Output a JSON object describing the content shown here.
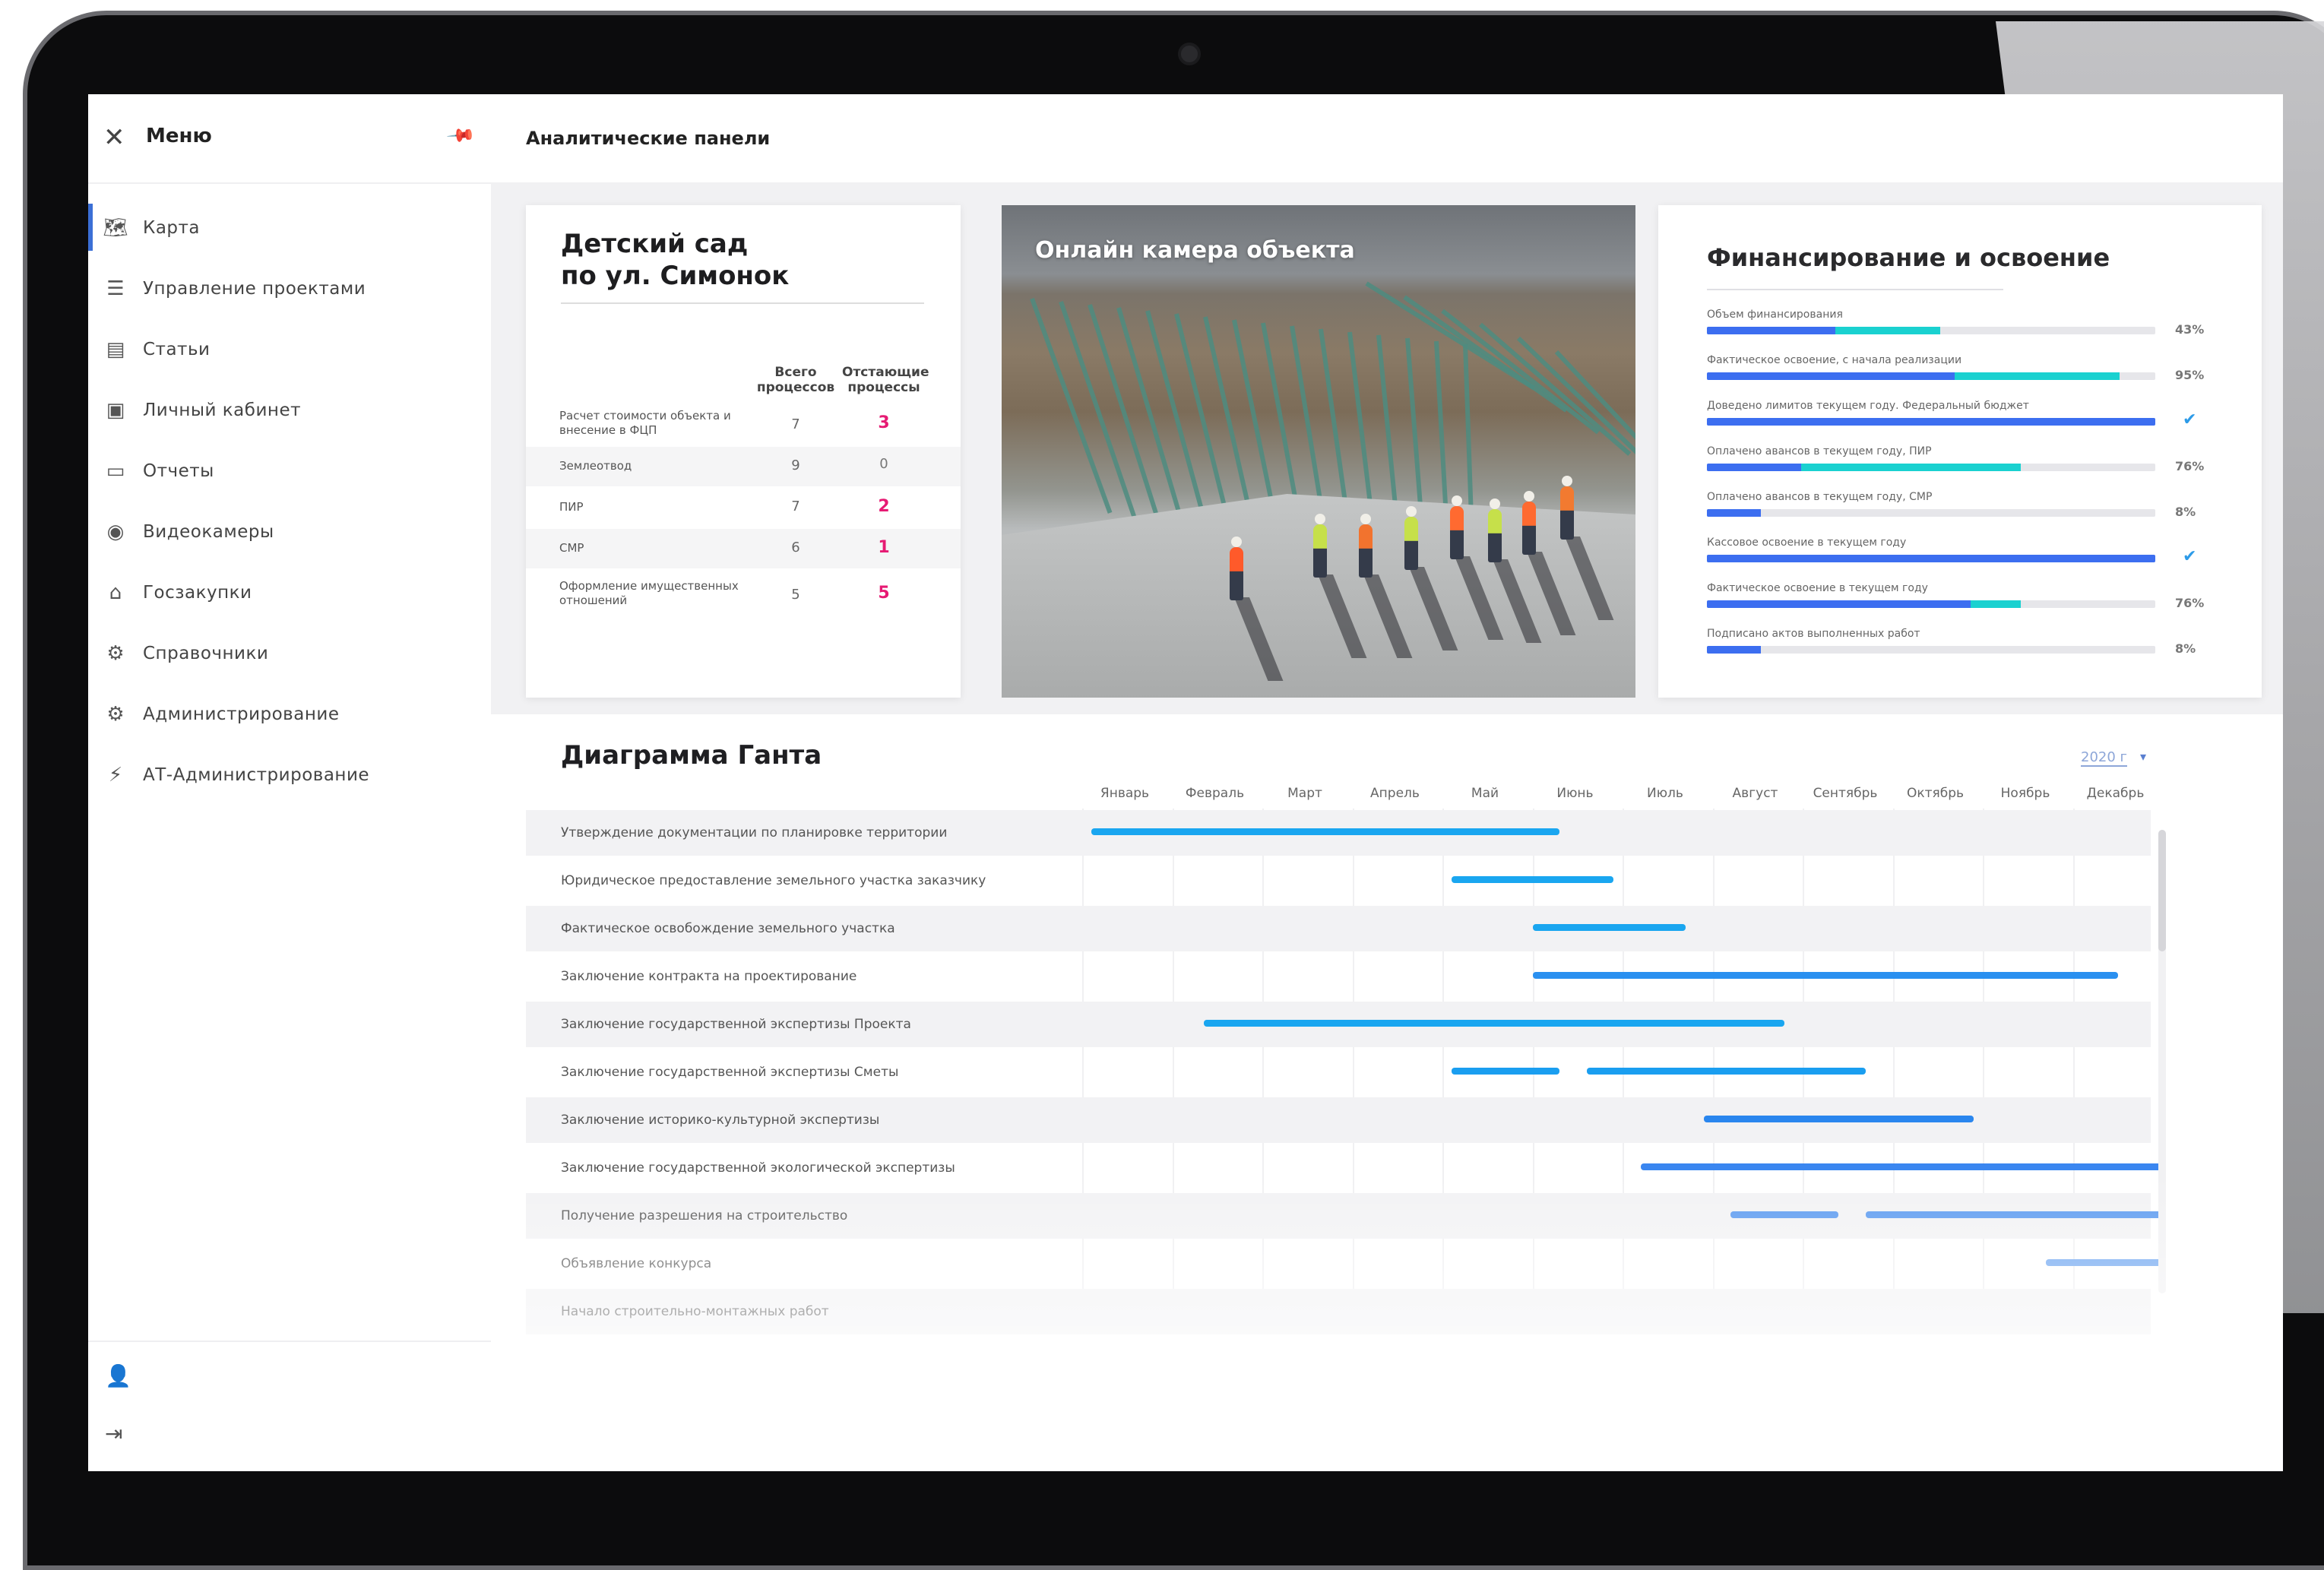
{
  "sidebar": {
    "title": "Меню",
    "items": [
      {
        "label": "Карта",
        "icon": "map-icon",
        "active": true
      },
      {
        "label": "Управление проектами",
        "icon": "project-manage-icon"
      },
      {
        "label": "Статьи",
        "icon": "article-icon"
      },
      {
        "label": "Личный кабинет",
        "icon": "profile-icon"
      },
      {
        "label": "Отчеты",
        "icon": "folder-icon"
      },
      {
        "label": "Видеокамеры",
        "icon": "camera-icon"
      },
      {
        "label": "Госзакупки",
        "icon": "bank-icon"
      },
      {
        "label": "Справочники",
        "icon": "gear-icon"
      },
      {
        "label": "Администрирование",
        "icon": "admin-icon"
      },
      {
        "label": "АТ-Администрирование",
        "icon": "bolt-icon"
      }
    ]
  },
  "header": {
    "title": "Аналитические панели"
  },
  "project_card": {
    "title_line1": "Детский сад",
    "title_line2": "по ул. Симонок",
    "col_total": "Всего процессов",
    "col_lagging": "Отстающие процессы",
    "rows": [
      {
        "label": "Расчет стоимости объекта и внесение в ФЦП",
        "total": "7",
        "lagging": "3"
      },
      {
        "label": "Землеотвод",
        "total": "9",
        "lagging": "0"
      },
      {
        "label": "ПИР",
        "total": "7",
        "lagging": "2"
      },
      {
        "label": "СМР",
        "total": "6",
        "lagging": "1"
      },
      {
        "label": "Оформление имущественных отношений",
        "total": "5",
        "lagging": "5"
      }
    ]
  },
  "camera": {
    "title": "Онлайн камера объекта"
  },
  "finance": {
    "title": "Финансирование и освоение",
    "rows": [
      {
        "label": "Объем финансирования",
        "value": "43%",
        "fill": 0.52,
        "split": 0.55,
        "check": false
      },
      {
        "label": "Фактическое освоение, с начала реализации",
        "value": "95%",
        "fill": 0.92,
        "split": 0.6,
        "check": false
      },
      {
        "label": "Доведено лимитов текущем году. Федеральный бюджет",
        "value": "",
        "fill": 1.0,
        "split": 1.0,
        "check": true
      },
      {
        "label": "Оплачено авансов в текущем году, ПИР",
        "value": "76%",
        "fill": 0.7,
        "split": 0.3,
        "check": false
      },
      {
        "label": "Оплачено авансов в текущем году, СМР",
        "value": "8%",
        "fill": 0.12,
        "split": 1.0,
        "check": false
      },
      {
        "label": "Кассовое освоение в текущем году",
        "value": "",
        "fill": 1.0,
        "split": 1.0,
        "check": true
      },
      {
        "label": "Фактическое освоение в текущем году",
        "value": "76%",
        "fill": 0.7,
        "split": 0.84,
        "check": false
      },
      {
        "label": "Подписано актов выполненных работ",
        "value": "8%",
        "fill": 0.12,
        "split": 1.0,
        "check": false
      }
    ]
  },
  "gantt": {
    "title": "Диаграмма Ганта",
    "year": "2020 г",
    "months": [
      "Январь",
      "Февраль",
      "Март",
      "Апрель",
      "Май",
      "Июнь",
      "Июль",
      "Август",
      "Сентябрь",
      "Октябрь",
      "Ноябрь",
      "Декабрь"
    ],
    "tasks": [
      {
        "label": "Утверждение документации по планировке территории",
        "bars": [
          [
            0.1,
            5.3
          ]
        ]
      },
      {
        "label": "Юридическое предоставление земельного участка заказчику",
        "bars": [
          [
            4.1,
            5.9
          ]
        ]
      },
      {
        "label": "Фактическое освобождение земельного участка",
        "bars": [
          [
            5.0,
            6.7
          ]
        ]
      },
      {
        "label": "Заключение контракта на проектирование",
        "bars": [
          [
            5.0,
            11.5
          ]
        ]
      },
      {
        "label": "Заключение государственной экспертизы Проекта",
        "bars": [
          [
            1.35,
            7.8
          ]
        ]
      },
      {
        "label": "Заключение государственной экспертизы Сметы",
        "bars": [
          [
            4.1,
            5.3
          ],
          [
            5.6,
            8.7
          ]
        ]
      },
      {
        "label": "Заключение историко-культурной экспертизы",
        "bars": [
          [
            6.9,
            9.9
          ]
        ]
      },
      {
        "label": "Заключение государственной экологической экспертизы",
        "bars": [
          [
            6.2,
            12.0
          ]
        ]
      },
      {
        "label": "Получение разрешения на строительство",
        "bars": [
          [
            7.2,
            8.4
          ],
          [
            8.7,
            12.0
          ]
        ]
      },
      {
        "label": "Объявление конкурса",
        "bars": [
          [
            10.7,
            12.0
          ]
        ]
      },
      {
        "label": "Начало строительно-монтажных работ",
        "bars": []
      }
    ]
  }
}
